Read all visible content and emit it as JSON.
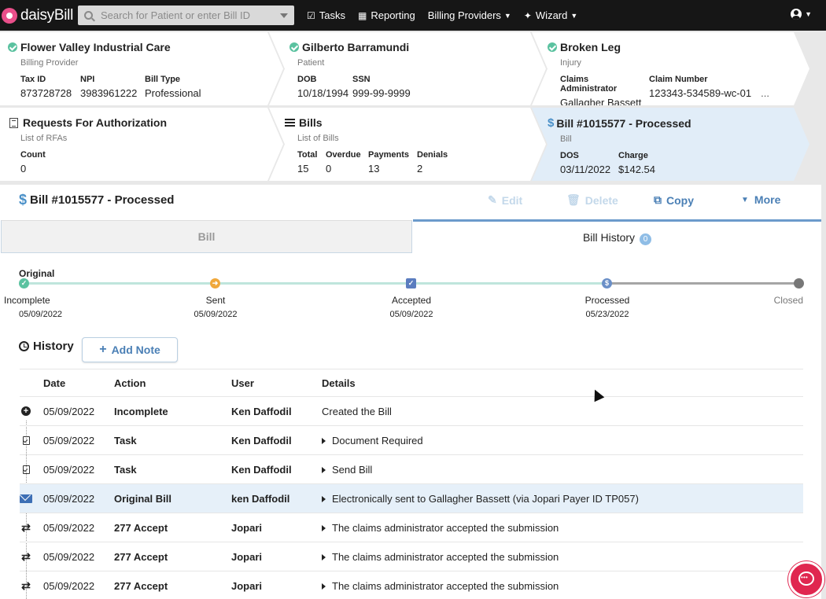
{
  "nav": {
    "brand": "daisyBill",
    "search_placeholder": "Search for Patient or enter Bill ID",
    "tasks": "Tasks",
    "reporting": "Reporting",
    "billing_providers": "Billing Providers",
    "wizard": "Wizard"
  },
  "cards": {
    "provider": {
      "title": "Flower Valley Industrial Care",
      "subtitle": "Billing Provider",
      "fields": [
        {
          "label": "Tax ID",
          "value": "873728728"
        },
        {
          "label": "NPI",
          "value": "3983961222"
        },
        {
          "label": "Bill Type",
          "value": "Professional"
        }
      ]
    },
    "patient": {
      "title": "Gilberto Barramundi",
      "subtitle": "Patient",
      "fields": [
        {
          "label": "DOB",
          "value": "10/18/1994"
        },
        {
          "label": "SSN",
          "value": "999-99-9999"
        }
      ]
    },
    "injury": {
      "title": "Broken Leg",
      "subtitle": "Injury",
      "fields": [
        {
          "label": "Claims Administrator",
          "value": "Gallagher Bassett"
        },
        {
          "label": "Claim Number",
          "value": "123343-534589-wc-01"
        }
      ],
      "overflow": "..."
    },
    "rfa": {
      "title": "Requests For Authorization",
      "subtitle": "List of RFAs",
      "fields": [
        {
          "label": "Count",
          "value": "0"
        }
      ]
    },
    "bills": {
      "title": "Bills",
      "subtitle": "List of Bills",
      "fields": [
        {
          "label": "Total",
          "value": "15"
        },
        {
          "label": "Overdue",
          "value": "0"
        },
        {
          "label": "Payments",
          "value": "13"
        },
        {
          "label": "Denials",
          "value": "2"
        }
      ]
    },
    "bill": {
      "title": "Bill #1015577 - Processed",
      "subtitle": "Bill",
      "fields": [
        {
          "label": "DOS",
          "value": "03/11/2022"
        },
        {
          "label": "Charge",
          "value": "$142.54"
        }
      ]
    }
  },
  "bill_header": {
    "title": "Bill #1015577 - Processed",
    "edit": "Edit",
    "delete": "Delete",
    "copy": "Copy",
    "more": "More"
  },
  "tabs": {
    "bill": "Bill",
    "history": "Bill History",
    "history_count": "0"
  },
  "timeline": {
    "label": "Original",
    "steps": [
      {
        "name": "Incomplete",
        "date": "05/09/2022"
      },
      {
        "name": "Sent",
        "date": "05/09/2022"
      },
      {
        "name": "Accepted",
        "date": "05/09/2022"
      },
      {
        "name": "Processed",
        "date": "05/23/2022"
      },
      {
        "name": "Closed",
        "date": ""
      }
    ]
  },
  "history": {
    "title": "History",
    "add_note": "Add Note",
    "columns": [
      "Date",
      "Action",
      "User",
      "Details"
    ],
    "rows": [
      {
        "icon": "plus-circle-icon",
        "date": "05/09/2022",
        "action": "Incomplete",
        "user": "Ken Daffodil",
        "details": "Created the Bill",
        "expand": false
      },
      {
        "icon": "clipboard-check-icon",
        "date": "05/09/2022",
        "action": "Task",
        "user": "Ken Daffodil",
        "details": "Document Required",
        "expand": true
      },
      {
        "icon": "clipboard-check-icon",
        "date": "05/09/2022",
        "action": "Task",
        "user": "Ken Daffodil",
        "details": "Send Bill",
        "expand": true
      },
      {
        "icon": "envelope-icon",
        "date": "05/09/2022",
        "action": "Original Bill",
        "user": "ken Daffodil",
        "details": "Electronically sent to Gallagher Bassett (via Jopari Payer ID TP057)",
        "expand": true
      },
      {
        "icon": "exchange-icon",
        "date": "05/09/2022",
        "action": "277 Accept",
        "user": "Jopari",
        "details": "The claims administrator accepted the submission",
        "expand": true
      },
      {
        "icon": "exchange-icon",
        "date": "05/09/2022",
        "action": "277 Accept",
        "user": "Jopari",
        "details": "The claims administrator accepted the submission",
        "expand": true
      },
      {
        "icon": "exchange-icon",
        "date": "05/09/2022",
        "action": "277 Accept",
        "user": "Jopari",
        "details": "The claims administrator accepted the submission",
        "expand": true
      }
    ]
  },
  "colors": {
    "accent": "#4a7fb5",
    "success": "#5bc2a0",
    "sent": "#f0a83c",
    "accepted": "#5b7dbf",
    "processed": "#6a8fc7",
    "pending": "#999999",
    "chat": "#e0264f"
  }
}
